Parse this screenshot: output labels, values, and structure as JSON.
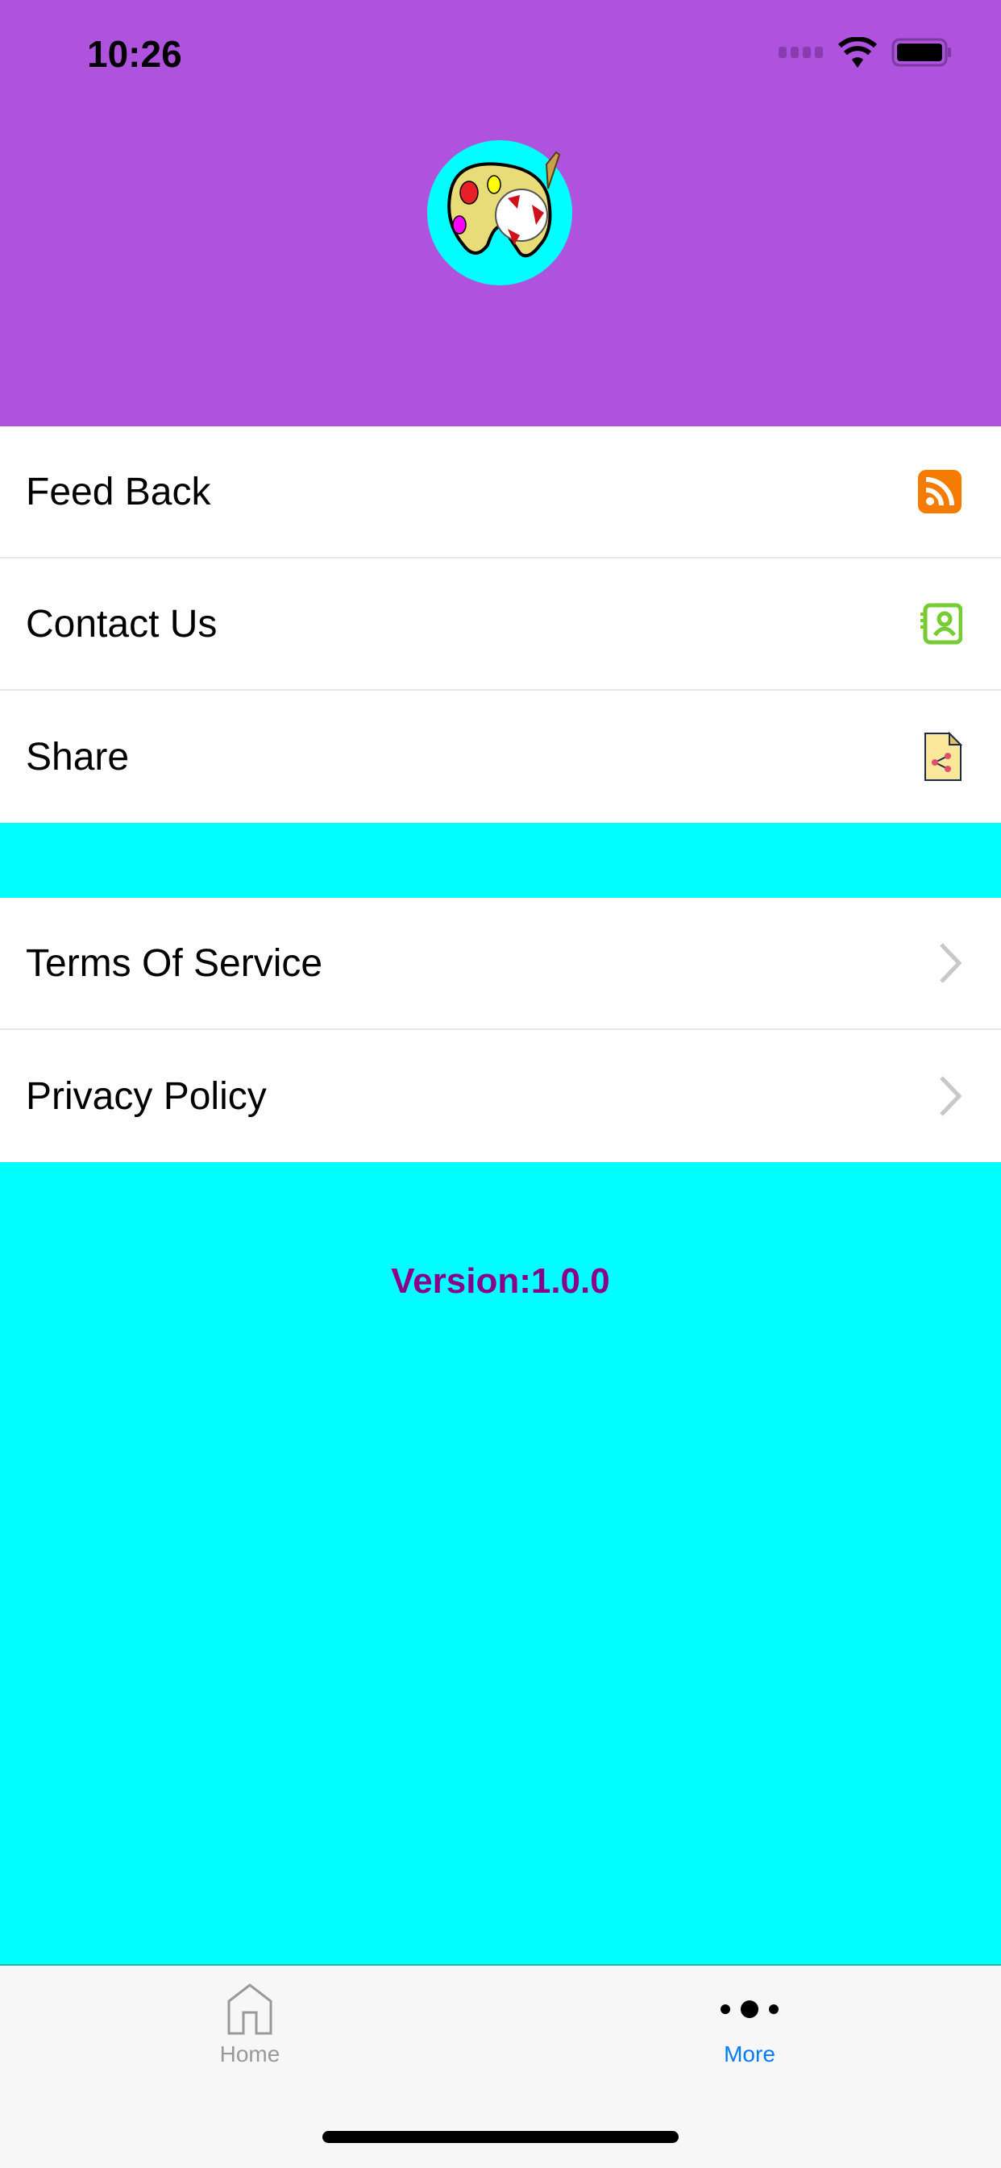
{
  "status_bar": {
    "time": "10:26"
  },
  "header": {
    "logo_icon": "palette-soccer-ball-logo",
    "background": "#af52de"
  },
  "menu_group_1": [
    {
      "label": "Feed Back",
      "icon": "rss-icon"
    },
    {
      "label": "Contact Us",
      "icon": "contact-book-icon"
    },
    {
      "label": "Share",
      "icon": "share-document-icon"
    }
  ],
  "menu_group_2": [
    {
      "label": "Terms Of Service",
      "icon": "chevron-right-icon"
    },
    {
      "label": "Privacy Policy",
      "icon": "chevron-right-icon"
    }
  ],
  "version": "Version:1.0.0",
  "tab_bar": {
    "tabs": [
      {
        "label": "Home",
        "icon": "home-icon",
        "active": false
      },
      {
        "label": "More",
        "icon": "more-dots-icon",
        "active": true
      }
    ],
    "active_color": "#007aff"
  },
  "colors": {
    "page_background": "#00ffff",
    "version_text": "#8b008b"
  }
}
